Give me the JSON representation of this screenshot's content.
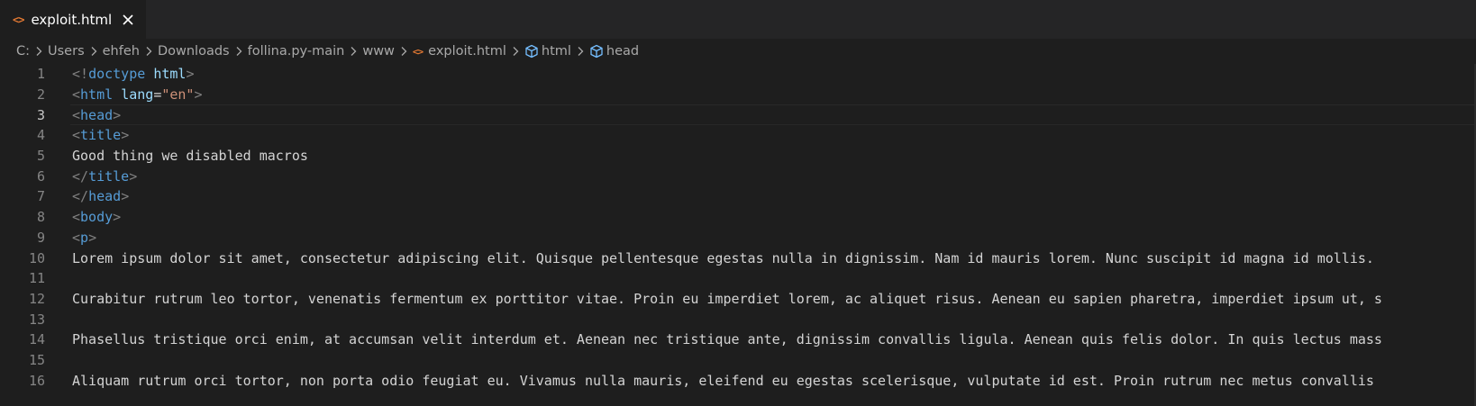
{
  "tab": {
    "label": "exploit.html",
    "icon": "html-file-icon",
    "icon_glyph": "<>"
  },
  "breadcrumb": {
    "items": [
      "C:",
      "Users",
      "ehfeh",
      "Downloads",
      "follina.py-main",
      "www"
    ],
    "file": "exploit.html",
    "symbols": [
      "html",
      "head"
    ]
  },
  "editor": {
    "current_line": 3,
    "lines": [
      {
        "n": "1",
        "t": [
          {
            "c": "tg",
            "v": "<!"
          },
          {
            "c": "tn",
            "v": "doctype"
          },
          {
            "c": "tx",
            "v": " "
          },
          {
            "c": "at",
            "v": "html"
          },
          {
            "c": "tg",
            "v": ">"
          }
        ]
      },
      {
        "n": "2",
        "t": [
          {
            "c": "tg",
            "v": "<"
          },
          {
            "c": "tn",
            "v": "html"
          },
          {
            "c": "tx",
            "v": " "
          },
          {
            "c": "at",
            "v": "lang"
          },
          {
            "c": "tx",
            "v": "="
          },
          {
            "c": "av",
            "v": "\"en\""
          },
          {
            "c": "tg",
            "v": ">"
          }
        ]
      },
      {
        "n": "3",
        "t": [
          {
            "c": "tg",
            "v": "<"
          },
          {
            "c": "tn",
            "v": "head"
          },
          {
            "c": "tg",
            "v": ">"
          }
        ]
      },
      {
        "n": "4",
        "t": [
          {
            "c": "tg",
            "v": "<"
          },
          {
            "c": "tn",
            "v": "title"
          },
          {
            "c": "tg",
            "v": ">"
          }
        ]
      },
      {
        "n": "5",
        "t": [
          {
            "c": "tx",
            "v": "Good thing we disabled macros"
          }
        ]
      },
      {
        "n": "6",
        "t": [
          {
            "c": "tg",
            "v": "</"
          },
          {
            "c": "tn",
            "v": "title"
          },
          {
            "c": "tg",
            "v": ">"
          }
        ]
      },
      {
        "n": "7",
        "t": [
          {
            "c": "tg",
            "v": "</"
          },
          {
            "c": "tn",
            "v": "head"
          },
          {
            "c": "tg",
            "v": ">"
          }
        ]
      },
      {
        "n": "8",
        "t": [
          {
            "c": "tg",
            "v": "<"
          },
          {
            "c": "tn",
            "v": "body"
          },
          {
            "c": "tg",
            "v": ">"
          }
        ]
      },
      {
        "n": "9",
        "t": [
          {
            "c": "tg",
            "v": "<"
          },
          {
            "c": "tn",
            "v": "p"
          },
          {
            "c": "tg",
            "v": ">"
          }
        ]
      },
      {
        "n": "10",
        "t": [
          {
            "c": "tx",
            "v": "Lorem ipsum dolor sit amet, consectetur adipiscing elit. Quisque pellentesque egestas nulla in dignissim. Nam id mauris lorem. Nunc suscipit id magna id mollis. "
          }
        ]
      },
      {
        "n": "11",
        "t": []
      },
      {
        "n": "12",
        "t": [
          {
            "c": "tx",
            "v": "Curabitur rutrum leo tortor, venenatis fermentum ex porttitor vitae. Proin eu imperdiet lorem, ac aliquet risus. Aenean eu sapien pharetra, imperdiet ipsum ut, s"
          }
        ]
      },
      {
        "n": "13",
        "t": []
      },
      {
        "n": "14",
        "t": [
          {
            "c": "tx",
            "v": "Phasellus tristique orci enim, at accumsan velit interdum et. Aenean nec tristique ante, dignissim convallis ligula. Aenean quis felis dolor. In quis lectus mass"
          }
        ]
      },
      {
        "n": "15",
        "t": []
      },
      {
        "n": "16",
        "t": [
          {
            "c": "tx",
            "v": "Aliquam rutrum orci tortor, non porta odio feugiat eu. Vivamus nulla mauris, eleifend eu egestas scelerisque, vulputate id est. Proin rutrum nec metus convallis "
          }
        ]
      }
    ]
  },
  "colors": {
    "background": "#1e1e1e",
    "tag_bracket": "#808080",
    "tag_name": "#569cd6",
    "attribute": "#9cdcfe",
    "attr_value": "#ce9178",
    "text": "#d4d4d4",
    "html_icon": "#e37933",
    "symbol_icon": "#75beff"
  }
}
